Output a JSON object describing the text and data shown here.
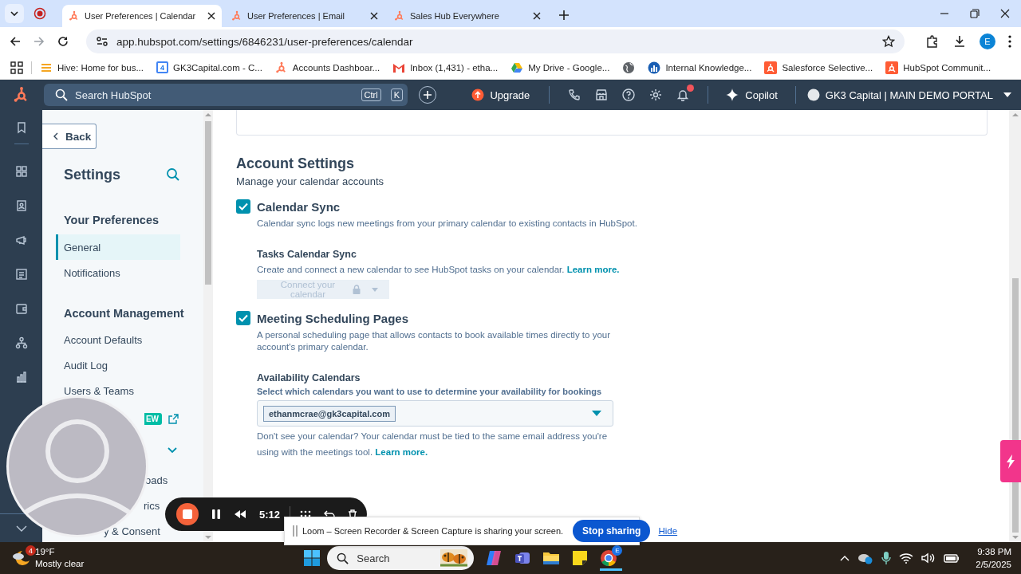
{
  "browser": {
    "tabs": [
      {
        "title": "User Preferences | Calendar",
        "selected": true
      },
      {
        "title": "User Preferences | Email",
        "selected": false
      },
      {
        "title": "Sales Hub Everywhere",
        "selected": false
      }
    ],
    "url": "app.hubspot.com/settings/6846231/user-preferences/calendar",
    "profile_initial": "E",
    "bookmarks": [
      {
        "kind": "hive",
        "label": "Hive: Home for bus..."
      },
      {
        "kind": "calendar",
        "icon_text": "4",
        "label": "GK3Capital.com - C..."
      },
      {
        "kind": "sprocket",
        "label": "Accounts Dashboar..."
      },
      {
        "kind": "mail",
        "label": "Inbox (1,431) - etha..."
      },
      {
        "kind": "drive",
        "label": "My Drive - Google..."
      },
      {
        "kind": "globe"
      },
      {
        "kind": "chart",
        "label": "Internal Knowledge..."
      },
      {
        "kind": "sprocket-box",
        "label": "Salesforce Selective..."
      },
      {
        "kind": "sprocket-box",
        "label": "HubSpot Communit..."
      }
    ]
  },
  "topnav": {
    "search_placeholder": "Search HubSpot",
    "shortcut": [
      "Ctrl",
      "K"
    ],
    "upgrade": "Upgrade",
    "notifications_unread": true,
    "copilot": "Copilot",
    "account": "GK3 Capital | MAIN DEMO PORTAL"
  },
  "sidebar": {
    "back": "Back",
    "title": "Settings",
    "sections": [
      {
        "heading": "Your Preferences",
        "items": [
          {
            "kind": "link",
            "label": "General",
            "selected": true,
            "expandable": false
          },
          {
            "kind": "link",
            "label": "Notifications",
            "selected": false,
            "expandable": false
          }
        ]
      },
      {
        "heading": "Account Management",
        "items": [
          {
            "kind": "link",
            "label": "Account Defaults",
            "selected": false,
            "expandable": false
          },
          {
            "kind": "link",
            "label": "Audit Log",
            "selected": false,
            "expandable": false
          },
          {
            "kind": "link",
            "label": "Users & Teams",
            "selected": false,
            "expandable": false
          },
          {
            "kind": "badge",
            "badge": "EW",
            "selected": false,
            "expandable": false
          },
          {
            "kind": "hidden",
            "selected": false,
            "expandable": true
          },
          {
            "kind": "cut",
            "label": "oads",
            "selected": false,
            "expandable": false
          },
          {
            "kind": "cut",
            "label": "rics",
            "selected": false,
            "expandable": false
          },
          {
            "kind": "cut",
            "label": "y & Consent",
            "selected": false,
            "expandable": false
          }
        ]
      }
    ]
  },
  "main": {
    "section_title": "Account Settings",
    "section_subtitle": "Manage your calendar accounts",
    "options": [
      {
        "title": "Calendar Sync",
        "checked": true,
        "description": "Calendar sync logs new meetings from your primary calendar to existing contacts in HubSpot.",
        "sub": {
          "kind": "button",
          "title": "Tasks Calendar Sync",
          "description": "Create and connect a new calendar to see HubSpot tasks on your calendar.",
          "link": "Learn more.",
          "button": "Connect your calendar",
          "disabled": true
        }
      },
      {
        "title": "Meeting Scheduling Pages",
        "checked": true,
        "description": "A personal scheduling page that allows contacts to book available times directly to your account's primary calendar.",
        "sub": {
          "kind": "select",
          "title": "Availability Calendars",
          "hint": "Select which calendars you want to use to determine your availability for bookings",
          "selected_calendars": [
            "ethanmcrae@gk3capital.com"
          ],
          "description": "Don't see your calendar? Your calendar must be tied to the same email address you're using with the meetings tool.",
          "link": "Learn more."
        }
      }
    ]
  },
  "loom": {
    "timer": "5:12",
    "banner_text": "Loom – Screen Recorder & Screen Capture is sharing your screen.",
    "stop_button": "Stop sharing",
    "hide_link": "Hide"
  },
  "taskbar": {
    "weather_badge": "4",
    "temperature": "19°F",
    "condition": "Mostly clear",
    "search_placeholder": "Search",
    "chrome_badge": "E",
    "time": "9:38 PM",
    "date": "2/5/2025"
  }
}
